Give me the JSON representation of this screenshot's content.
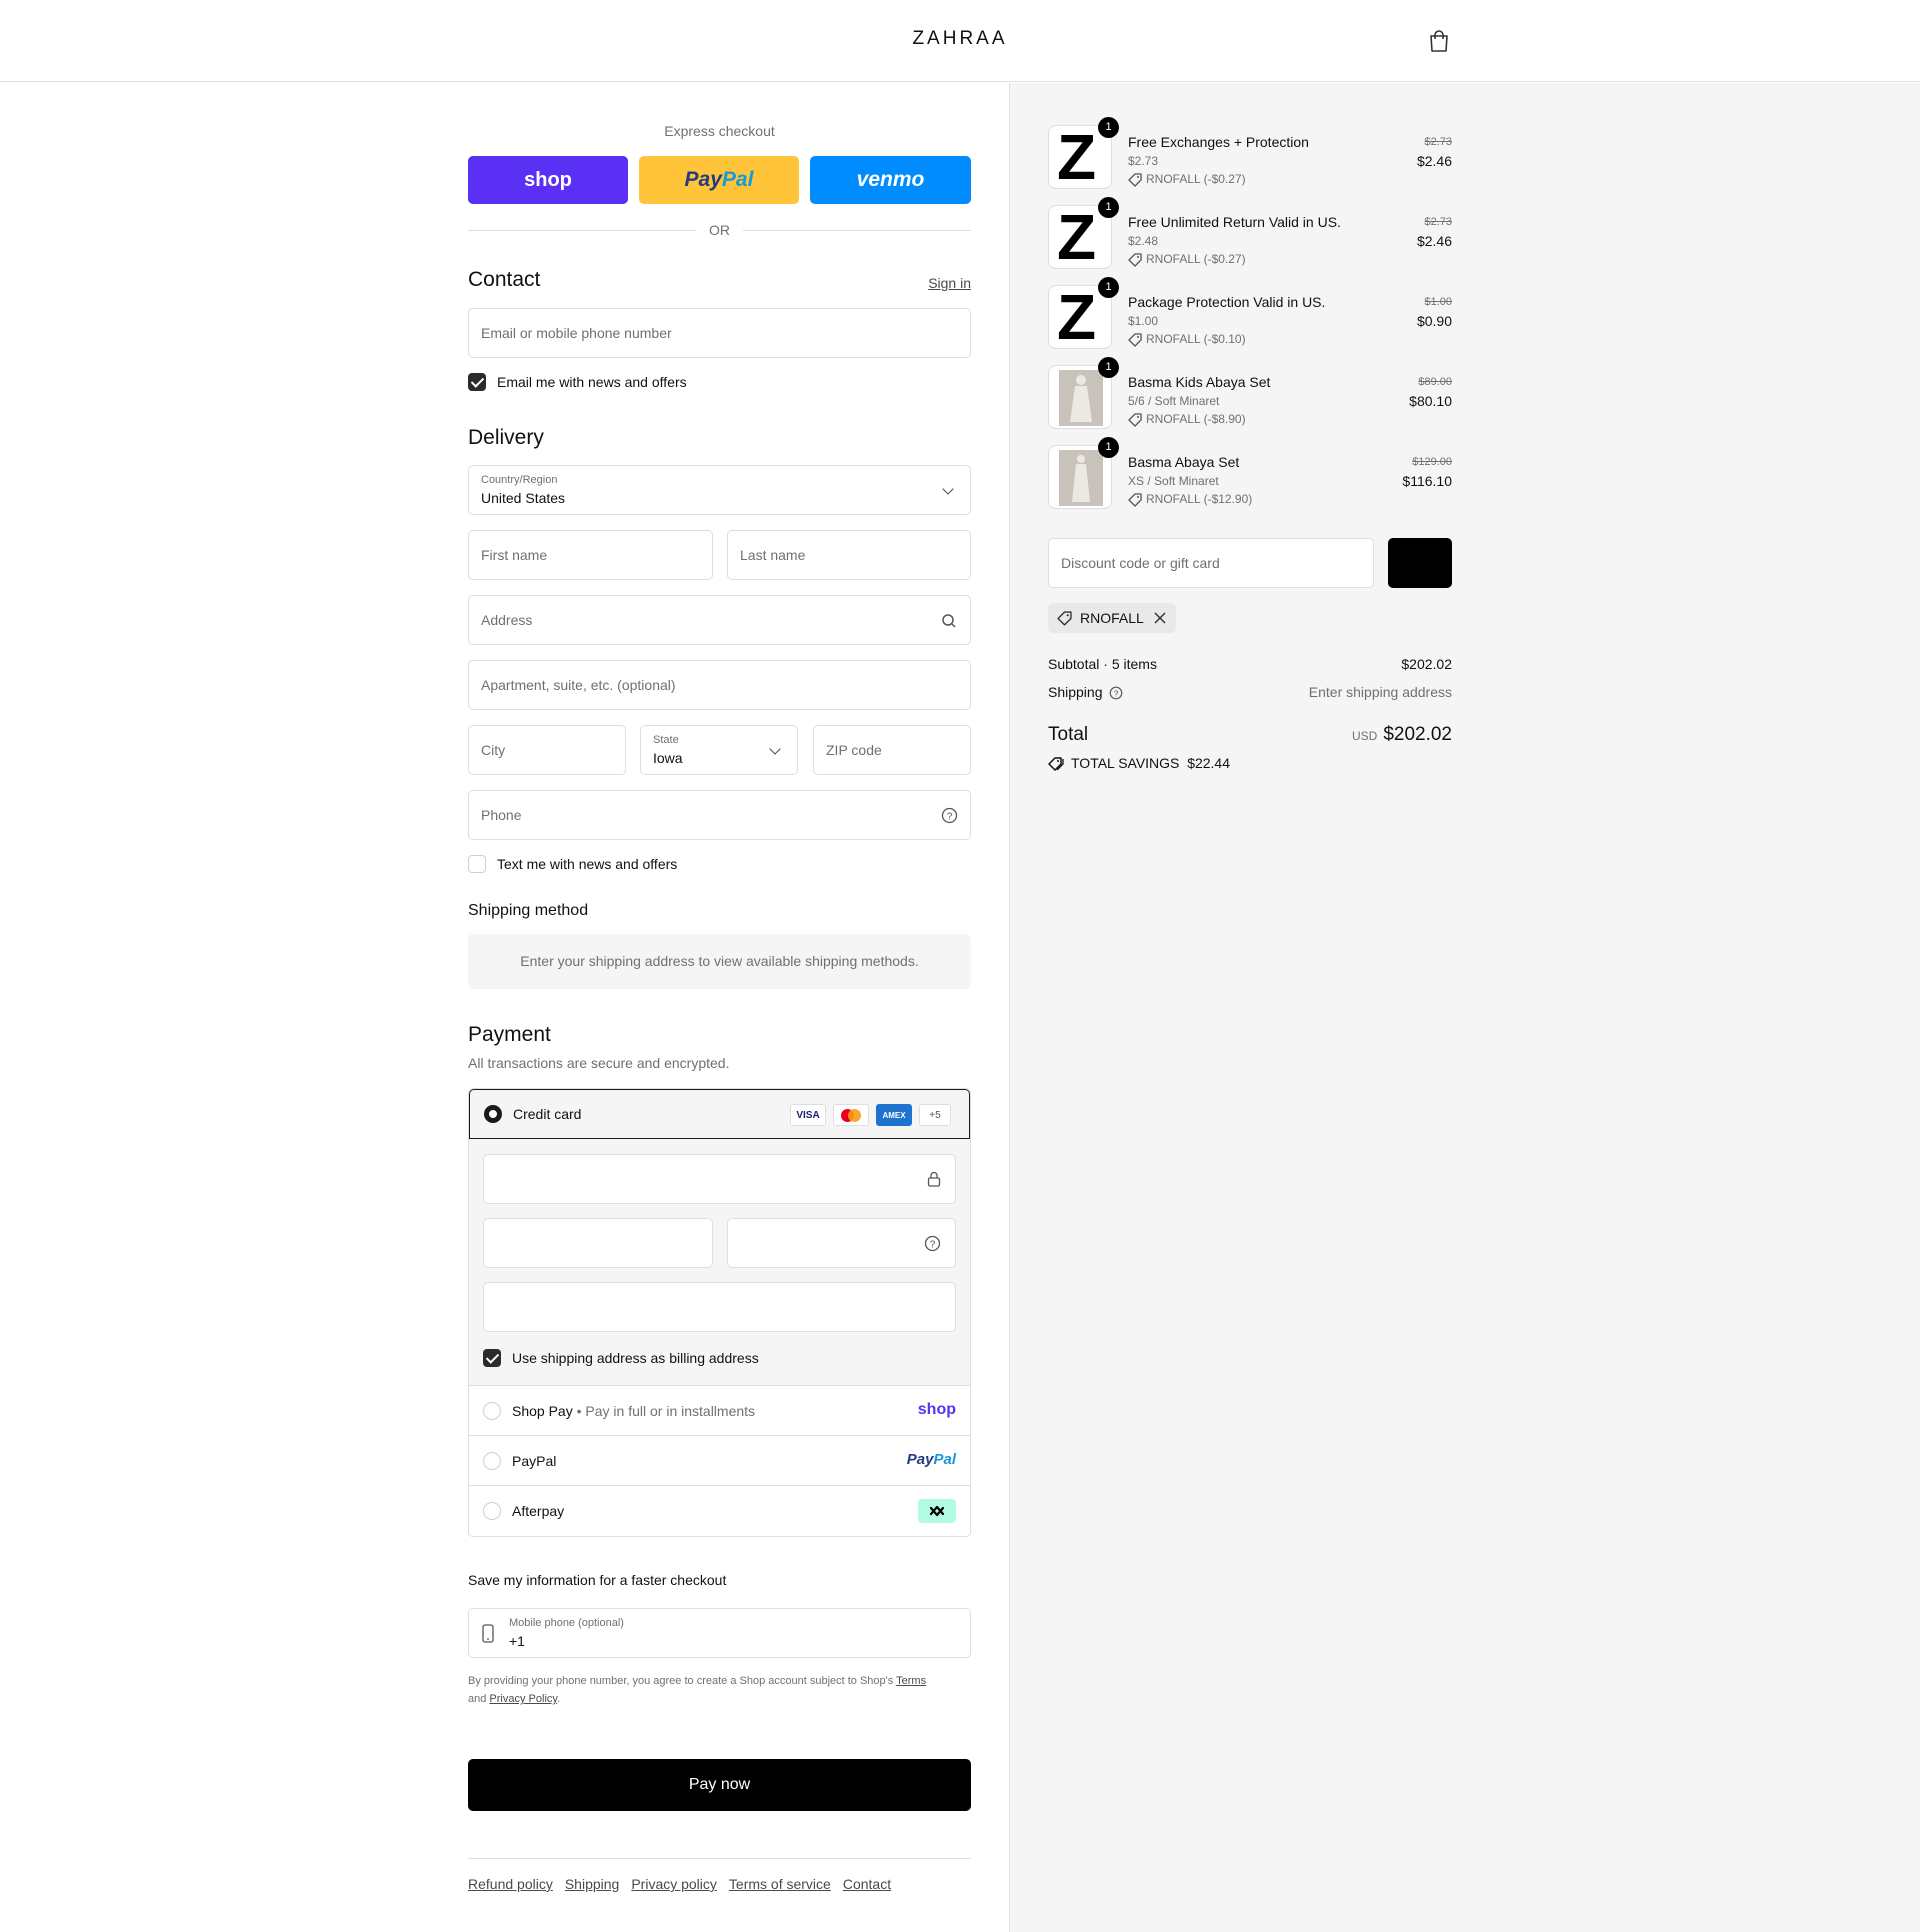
{
  "header": {
    "brand": "ZAHRAA",
    "cart_icon": "shopping-bag-icon"
  },
  "express": {
    "title": "Express checkout",
    "shop_label": "shop",
    "paypal_label_a": "Pay",
    "paypal_label_b": "Pal",
    "venmo_label": "venmo",
    "or_label": "OR",
    "colors": {
      "shop": "#5a31f4",
      "paypal": "#ffc439",
      "venmo": "#008cff"
    }
  },
  "contact": {
    "title": "Contact",
    "sign_in": "Sign in",
    "email_placeholder": "Email or mobile phone number",
    "news_label": "Email me with news and offers",
    "news_checked": true
  },
  "delivery": {
    "title": "Delivery",
    "country_label": "Country/Region",
    "country_value": "United States",
    "first_name": "First name",
    "last_name": "Last name",
    "address": "Address",
    "apartment": "Apartment, suite, etc. (optional)",
    "city": "City",
    "state_label": "State",
    "state_value": "Iowa",
    "zip": "ZIP code",
    "phone": "Phone",
    "text_label": "Text me with news and offers",
    "text_checked": false
  },
  "shipping_method": {
    "title": "Shipping method",
    "message": "Enter your shipping address to view available shipping methods."
  },
  "payment": {
    "title": "Payment",
    "subtitle": "All transactions are secure and encrypted.",
    "credit_card": "Credit card",
    "cards": [
      "VISA",
      "MC",
      "AMEX",
      "+5"
    ],
    "billing_label": "Use shipping address as billing address",
    "billing_checked": true,
    "shop_pay": "Shop Pay",
    "shop_pay_sub": "Pay in full or in installments",
    "shop_pay_logo": "shop",
    "paypal": "PayPal",
    "paypal_logo_a": "Pay",
    "paypal_logo_b": "Pal",
    "afterpay": "Afterpay"
  },
  "save_info": {
    "title": "Save my information for a faster checkout",
    "phone_label": "Mobile phone (optional)",
    "phone_value": "+1",
    "legal_prefix": "By providing your phone number, you agree to create a Shop account subject to Shop's",
    "terms": "Terms",
    "and": "and",
    "privacy": "Privacy Policy",
    "period": "."
  },
  "pay_now": "Pay now",
  "footer_links": [
    "Refund policy",
    "Shipping",
    "Privacy policy",
    "Terms of service",
    "Contact"
  ],
  "cart": {
    "items": [
      {
        "name": "Free Exchanges + Protection",
        "sub": "$2.73",
        "discount": "RNOFALL (-$0.27)",
        "old_price": "$2.73",
        "price": "$2.46",
        "qty": "1",
        "thumb": "Z"
      },
      {
        "name": "Free Unlimited Return Valid in US.",
        "sub": "$2.48",
        "discount": "RNOFALL (-$0.27)",
        "old_price": "$2.73",
        "price": "$2.46",
        "qty": "1",
        "thumb": "Z"
      },
      {
        "name": "Package Protection Valid in US.",
        "sub": "$1.00",
        "discount": "RNOFALL (-$0.10)",
        "old_price": "$1.00",
        "price": "$0.90",
        "qty": "1",
        "thumb": "Z"
      },
      {
        "name": "Basma Kids Abaya Set",
        "sub": "5/6 / Soft Minaret",
        "discount": "RNOFALL (-$8.90)",
        "old_price": "$89.00",
        "price": "$80.10",
        "qty": "1",
        "thumb": "photo"
      },
      {
        "name": "Basma Abaya Set",
        "sub": "XS / Soft Minaret",
        "discount": "RNOFALL (-$12.90)",
        "old_price": "$129.00",
        "price": "$116.10",
        "qty": "1",
        "thumb": "photo"
      }
    ],
    "discount_placeholder": "Discount code or gift card",
    "applied_code": "RNOFALL",
    "subtotal_label": "Subtotal · 5 items",
    "subtotal_value": "$202.02",
    "shipping_label": "Shipping",
    "shipping_value": "Enter shipping address",
    "total_label": "Total",
    "currency": "USD",
    "total_value": "$202.02",
    "savings_label": "TOTAL SAVINGS",
    "savings_value": "$22.44"
  }
}
